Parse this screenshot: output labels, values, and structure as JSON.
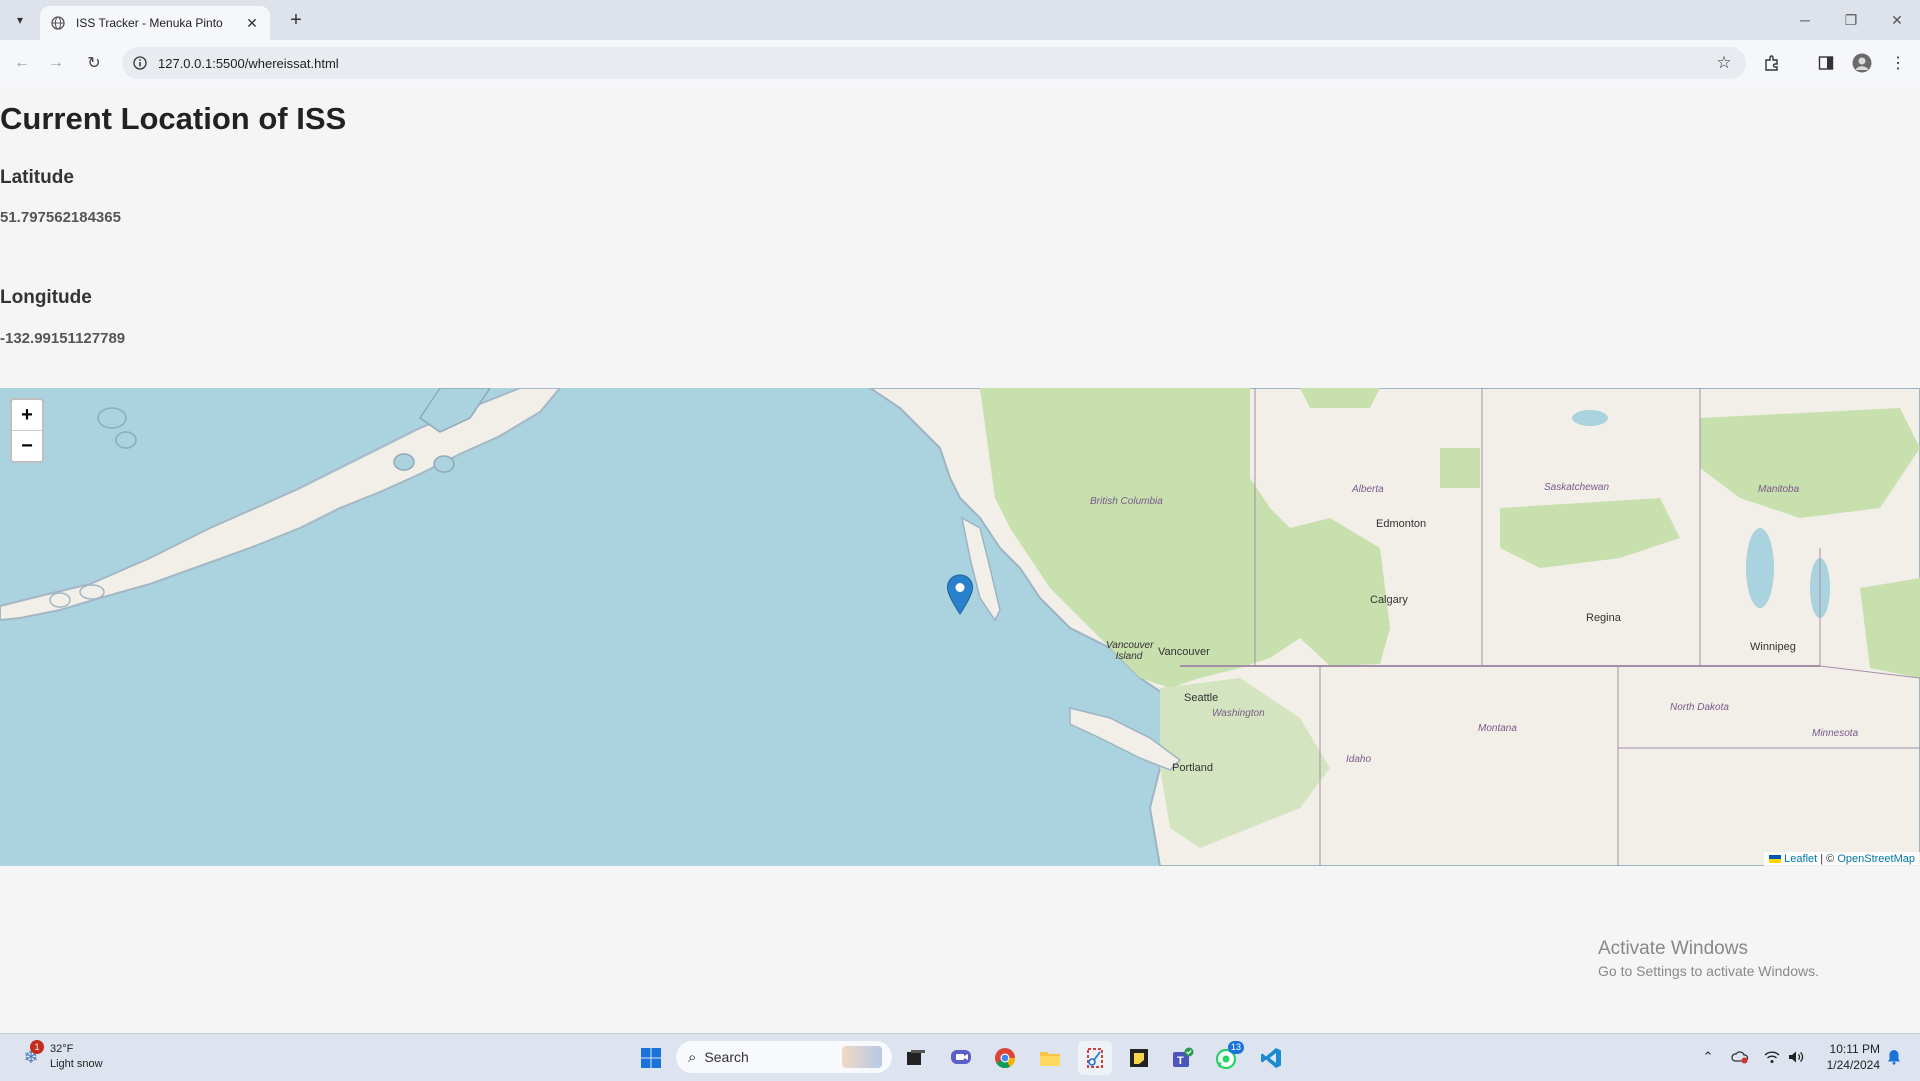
{
  "browser": {
    "tab_title": "ISS Tracker - Menuka Pinto",
    "url": "127.0.0.1:5500/whereissat.html"
  },
  "page": {
    "heading": "Current Location of ISS",
    "latitude_label": "Latitude",
    "latitude_value": "51.797562184365",
    "longitude_label": "Longitude",
    "longitude_value": "-132.99151127789"
  },
  "map": {
    "zoom_in": "+",
    "zoom_out": "−",
    "attribution_leaflet": "Leaflet",
    "attribution_sep": " | © ",
    "attribution_osm": "OpenStreetMap",
    "labels": {
      "british_columbia": "British Columbia",
      "alberta": "Alberta",
      "saskatchewan": "Saskatchewan",
      "manitoba": "Manitoba",
      "edmonton": "Edmonton",
      "calgary": "Calgary",
      "regina": "Regina",
      "winnipeg": "Winnipeg",
      "vancouver_island": "Vancouver Island",
      "vancouver": "Vancouver",
      "seattle": "Seattle",
      "washington": "Washington",
      "montana": "Montana",
      "north_dakota": "North Dakota",
      "minnesota": "Minnesota",
      "idaho": "Idaho",
      "portland": "Portland"
    },
    "colors": {
      "water": "#aad3df",
      "land": "#f2efe9",
      "forest": "#c8dfae",
      "border": "#a48fa8"
    }
  },
  "activate_windows": {
    "title": "Activate Windows",
    "subtitle": "Go to Settings to activate Windows."
  },
  "taskbar": {
    "weather_temp": "32°F",
    "weather_desc": "Light snow",
    "weather_badge": "1",
    "search_placeholder": "Search",
    "time": "10:11 PM",
    "date": "1/24/2024",
    "whatsapp_badge": "13"
  }
}
